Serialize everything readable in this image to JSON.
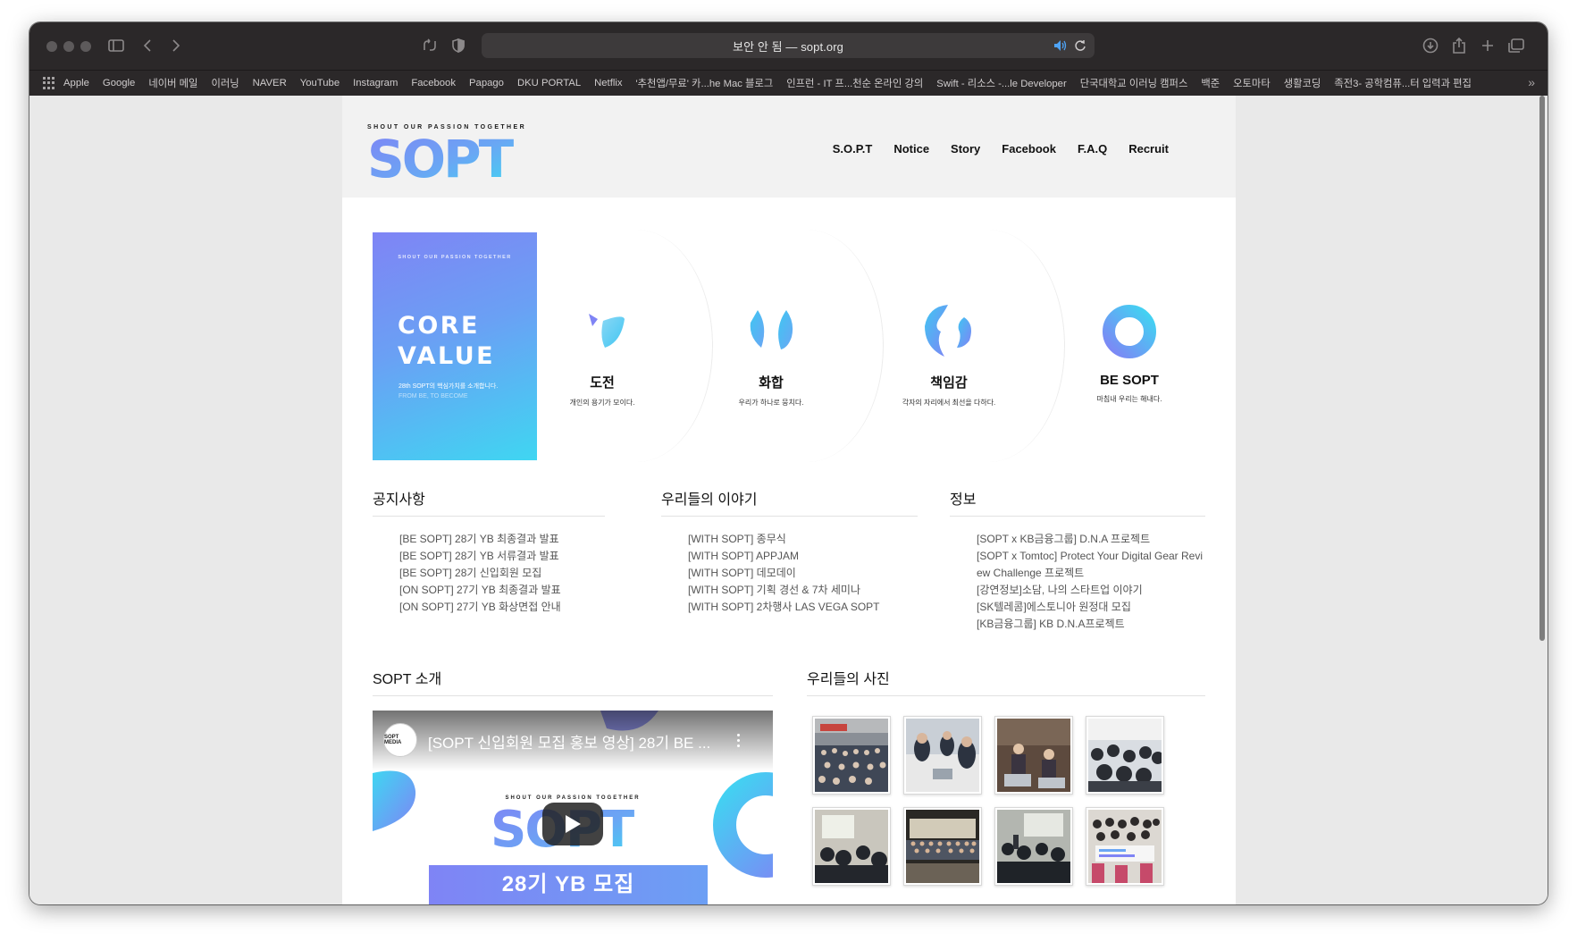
{
  "browser": {
    "url_text": "보안 안 됨 — sopt.org",
    "bookmarks": [
      "Apple",
      "Google",
      "네이버 메일",
      "이러닝",
      "NAVER",
      "YouTube",
      "Instagram",
      "Facebook",
      "Papago",
      "DKU PORTAL",
      "Netflix",
      "'추천앱/무료' 카...he Mac 블로그",
      "인프런 - IT 프...천순 온라인 강의",
      "Swift - 리소스 -...le Developer",
      "단국대학교 이러닝 캠퍼스",
      "백준",
      "오토마타",
      "생활코딩",
      "족전3- 공학컴퓨...터 입력과 편집"
    ]
  },
  "site": {
    "logo_tagline": "SHOUT OUR PASSION TOGETHER",
    "logo_text": "SOPT",
    "nav": [
      "S.O.P.T",
      "Notice",
      "Story",
      "Facebook",
      "F.A.Q",
      "Recruit"
    ]
  },
  "core_value": {
    "tagline": "SHOUT OUR PASSION TOGETHER",
    "title_line1": "CORE",
    "title_line2": "VALUE",
    "sub1": "28th SOPT의 핵심가치를 소개합니다.",
    "sub2": "FROM BE, TO BECOME",
    "values": [
      {
        "title": "도전",
        "desc": "개인의 용기가 모이다."
      },
      {
        "title": "화합",
        "desc": "우리가 하나로 뭉치다."
      },
      {
        "title": "책임감",
        "desc": "각자의 자리에서 최선을 다하다."
      },
      {
        "title": "BE SOPT",
        "desc": "마침내 우리는 해내다."
      }
    ]
  },
  "notice": {
    "title": "공지사항",
    "items": [
      "[BE SOPT] 28기 YB 최종결과 발표",
      "[BE SOPT] 28기 YB 서류결과 발표",
      "[BE SOPT] 28기 신입회원 모집",
      "[ON SOPT] 27기 YB 최종결과 발표",
      "[ON SOPT] 27기 YB 화상면접 안내"
    ]
  },
  "story": {
    "title": "우리들의 이야기",
    "items": [
      "[WITH SOPT] 종무식",
      "[WITH SOPT] APPJAM",
      "[WITH SOPT] 데모데이",
      "[WITH SOPT] 기획 경선 & 7차 세미나",
      "[WITH SOPT] 2차행사 LAS VEGA SOPT"
    ]
  },
  "info": {
    "title": "정보",
    "items": [
      "[SOPT x KB금융그룹] D.N.A 프로젝트",
      "[SOPT x Tomtoc] Protect Your Digital Gear Revi",
      "ew Challenge 프로젝트",
      "[강연정보]소담, 나의 스타트업 이야기",
      "[SK텔레콤]에스토니아 원정대 모집",
      "[KB금융그룹] KB D.N.A프로젝트"
    ]
  },
  "intro": {
    "title": "SOPT 소개",
    "video_title": "[SOPT 신입회원 모집 홍보 영상] 28기 BE ...",
    "channel_badge": "SOPT MEDIA",
    "video_tagline": "SHOUT OUR PASSION TOGETHER",
    "video_banner": "28기 YB 모집"
  },
  "photos": {
    "title": "우리들의 사진"
  },
  "colors": {
    "accent_purple": "#7f84f5",
    "accent_blue": "#3fd6f2",
    "titlebar": "#2b2829"
  }
}
